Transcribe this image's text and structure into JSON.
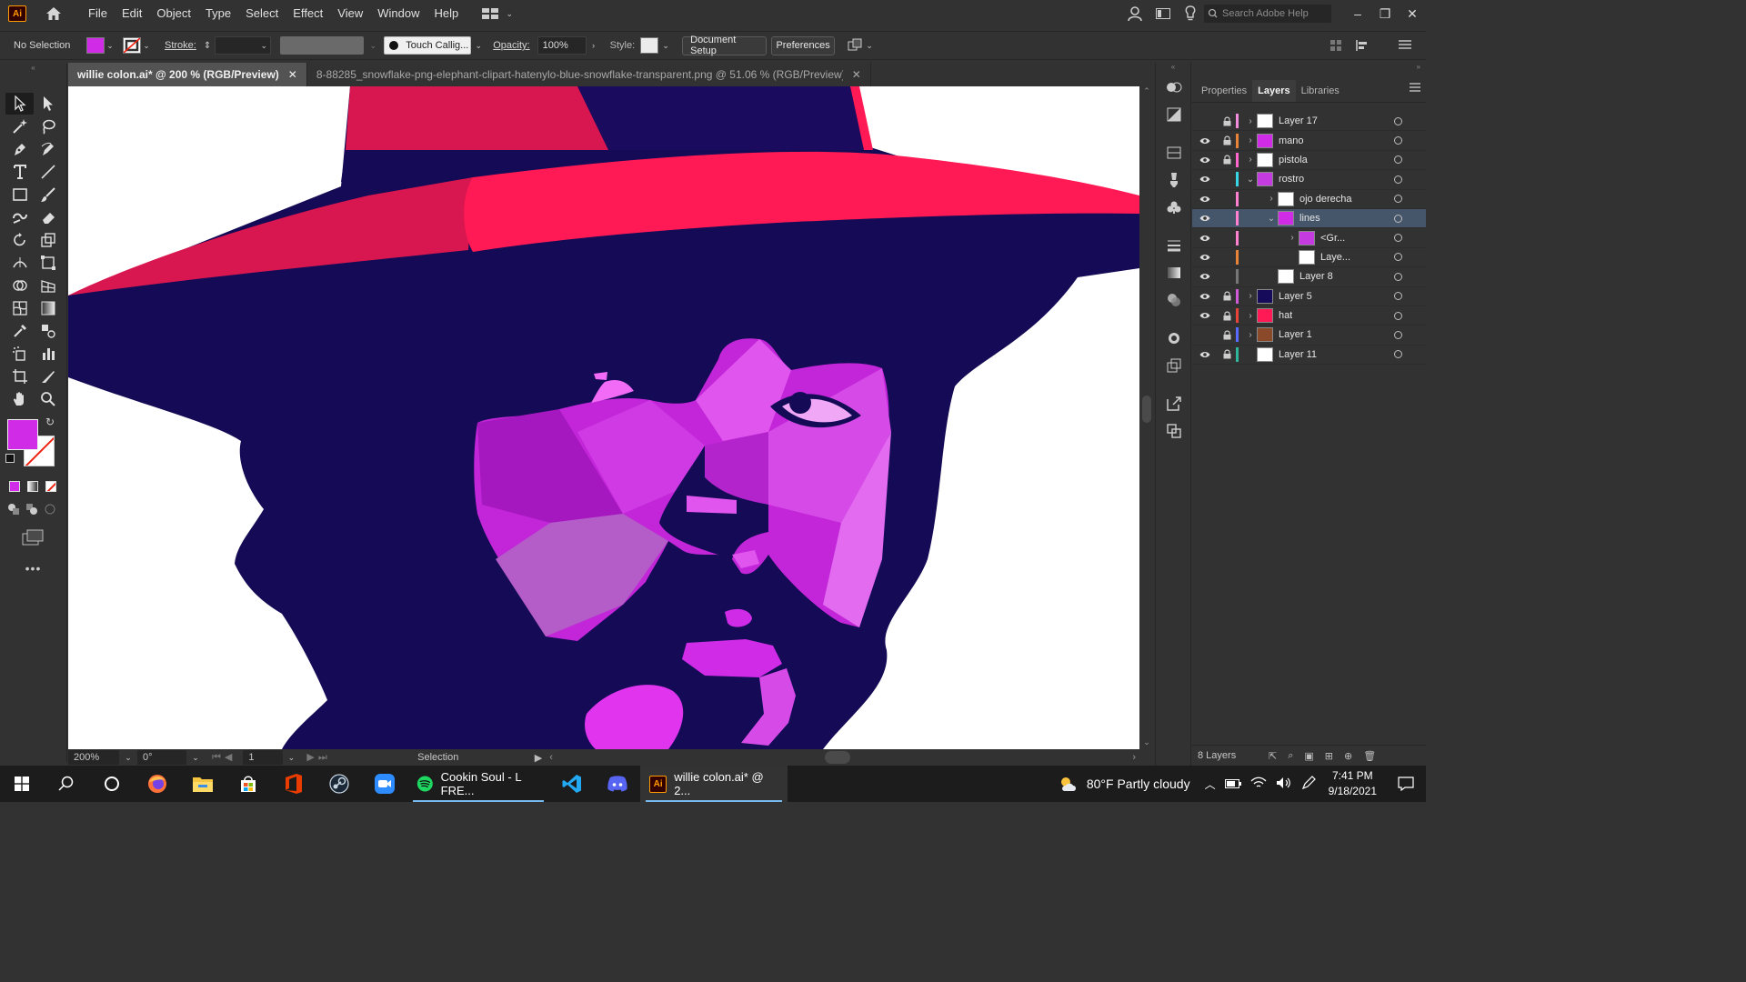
{
  "app": {
    "logo_text": "Ai",
    "menu": [
      "File",
      "Edit",
      "Object",
      "Type",
      "Select",
      "Effect",
      "View",
      "Window",
      "Help"
    ],
    "search_placeholder": "Search Adobe Help"
  },
  "controlbar": {
    "selection_label": "No Selection",
    "fill_color": "#d02ce8",
    "stroke_label": "Stroke:",
    "brush_name": "Touch Callig...",
    "opacity_label": "Opacity:",
    "opacity_value": "100%",
    "style_label": "Style:",
    "document_setup": "Document Setup",
    "preferences": "Preferences"
  },
  "tabs": [
    {
      "label": "willie colon.ai* @ 200 % (RGB/Preview)",
      "active": true
    },
    {
      "label": "8-88285_snowflake-png-elephant-clipart-hatenylo-blue-snowflake-transparent.png @ 51.06 % (RGB/Preview)",
      "active": false
    }
  ],
  "statusbar": {
    "zoom": "200%",
    "rotation": "0°",
    "artboard": "1",
    "tool": "Selection"
  },
  "panel": {
    "tabs": [
      "Properties",
      "Layers",
      "Libraries"
    ],
    "active_tab": "Layers",
    "footer_count": "8 Layers",
    "layers": [
      {
        "name": "Layer 17",
        "visible": false,
        "locked": true,
        "color": "#f38bdc",
        "indent": 0,
        "expander": ">",
        "thumb": "#fff",
        "selected": false
      },
      {
        "name": "mano",
        "visible": true,
        "locked": true,
        "color": "#e8833a",
        "indent": 0,
        "expander": ">",
        "thumb": "#d02ce8",
        "selected": false
      },
      {
        "name": "pistola",
        "visible": true,
        "locked": true,
        "color": "#ff66cc",
        "indent": 0,
        "expander": ">",
        "thumb": "#fff",
        "selected": false
      },
      {
        "name": "rostro",
        "visible": true,
        "locked": false,
        "color": "#39d7e6",
        "indent": 0,
        "expander": "v",
        "thumb": "#c43ce0",
        "selected": false
      },
      {
        "name": "ojo derecha",
        "visible": true,
        "locked": false,
        "color": "#ff7fd0",
        "indent": 1,
        "expander": ">",
        "thumb": "#fff",
        "selected": false
      },
      {
        "name": "lines",
        "visible": true,
        "locked": false,
        "color": "#ff7fd0",
        "indent": 1,
        "expander": "v",
        "thumb": "#d02ce8",
        "selected": true
      },
      {
        "name": "<Gr...",
        "visible": true,
        "locked": false,
        "color": "#ff7fd0",
        "indent": 2,
        "expander": ">",
        "thumb": "#c43ce0",
        "selected": false
      },
      {
        "name": "Laye...",
        "visible": true,
        "locked": false,
        "color": "#e8833a",
        "indent": 2,
        "expander": "",
        "thumb": "#fff",
        "selected": false
      },
      {
        "name": "Layer 8",
        "visible": true,
        "locked": false,
        "color": "#777777",
        "indent": 1,
        "expander": "",
        "thumb": "#fff",
        "selected": false
      },
      {
        "name": "Layer 5",
        "visible": true,
        "locked": true,
        "color": "#d05bd8",
        "indent": 0,
        "expander": ">",
        "thumb": "#160a5a",
        "selected": false
      },
      {
        "name": "hat",
        "visible": true,
        "locked": true,
        "color": "#e8443a",
        "indent": 0,
        "expander": ">",
        "thumb": "#ff1a55",
        "selected": false
      },
      {
        "name": "Layer 1",
        "visible": false,
        "locked": true,
        "color": "#5a6cff",
        "indent": 0,
        "expander": ">",
        "thumb": "#8a4a2a",
        "selected": false
      },
      {
        "name": "Layer 11",
        "visible": true,
        "locked": true,
        "color": "#2fb59a",
        "indent": 0,
        "expander": "",
        "thumb": "#fff",
        "selected": false
      }
    ]
  },
  "taskbar": {
    "apps": [
      "windows-start",
      "search",
      "cortana",
      "firefox",
      "file-explorer",
      "store",
      "office",
      "steam",
      "zoom"
    ],
    "spotify_label": "Cookin Soul - L FRE...",
    "illustrator_label": "willie colon.ai* @ 2...",
    "weather": "80°F  Partly cloudy",
    "time": "7:41 PM",
    "date": "9/18/2021"
  },
  "colors": {
    "navy": "#150a55",
    "hat_red": "#ff1a55",
    "hat_dark_red": "#d8164f",
    "face_magenta": "#d02ce8"
  }
}
